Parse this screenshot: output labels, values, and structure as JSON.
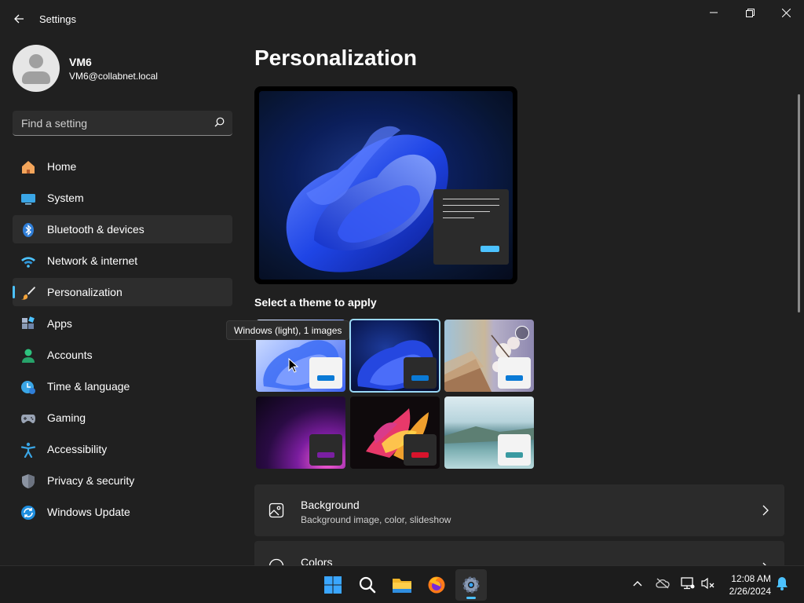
{
  "window": {
    "title": "Settings",
    "controls": [
      "minimize",
      "restore",
      "close"
    ]
  },
  "profile": {
    "name": "VM6",
    "email": "VM6@collabnet.local"
  },
  "search": {
    "placeholder": "Find a setting"
  },
  "nav": {
    "items": [
      {
        "label": "Home",
        "icon": "home-icon"
      },
      {
        "label": "System",
        "icon": "system-icon"
      },
      {
        "label": "Bluetooth & devices",
        "icon": "bluetooth-icon"
      },
      {
        "label": "Network & internet",
        "icon": "wifi-icon"
      },
      {
        "label": "Personalization",
        "icon": "brush-icon"
      },
      {
        "label": "Apps",
        "icon": "apps-icon"
      },
      {
        "label": "Accounts",
        "icon": "accounts-icon"
      },
      {
        "label": "Time & language",
        "icon": "time-language-icon"
      },
      {
        "label": "Gaming",
        "icon": "gamepad-icon"
      },
      {
        "label": "Accessibility",
        "icon": "accessibility-icon"
      },
      {
        "label": "Privacy & security",
        "icon": "shield-icon"
      },
      {
        "label": "Windows Update",
        "icon": "update-icon"
      }
    ],
    "selected": "Personalization",
    "hovered": "Bluetooth & devices"
  },
  "main": {
    "title": "Personalization",
    "themes_label": "Select a theme to apply",
    "tooltip": "Windows (light), 1 images",
    "cards": [
      {
        "title": "Background",
        "subtitle": "Background image, color, slideshow",
        "icon": "image-icon"
      },
      {
        "title": "Colors",
        "subtitle": "",
        "icon": "palette-icon"
      }
    ]
  },
  "colors": {
    "accent": "#4cc2ff",
    "background": "#202020",
    "card": "#2b2b2b"
  },
  "taskbar": {
    "apps": [
      "windows-start-icon",
      "search-icon",
      "file-explorer-icon",
      "firefox-icon",
      "settings-icon"
    ],
    "active_app": "settings-icon",
    "tray": [
      "chevron-up-icon",
      "onedrive-icon",
      "network-icon",
      "volume-muted-icon"
    ],
    "time": "12:08 AM",
    "date": "2/26/2024"
  }
}
